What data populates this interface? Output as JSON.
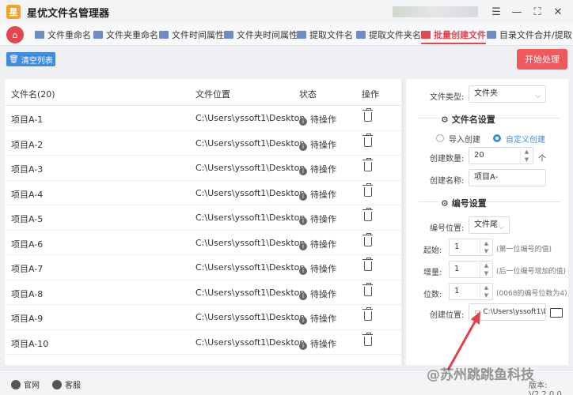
{
  "app": {
    "title": "星优文件名管理器",
    "logo": "星"
  },
  "window": {
    "icons": [
      "menu-icon",
      "minimize-icon",
      "maximize-icon",
      "close-icon"
    ]
  },
  "tabs": [
    {
      "label": "文件重命名"
    },
    {
      "label": "文件夹重命名"
    },
    {
      "label": "文件时间属性"
    },
    {
      "label": "文件夹时间属性"
    },
    {
      "label": "提取文件名"
    },
    {
      "label": "提取文件夹名"
    },
    {
      "label": "批量创建文件"
    },
    {
      "label": "目录文件合并/提取"
    }
  ],
  "active_tab": "批量创建文件",
  "toolbar": {
    "clear_label": "清空列表",
    "start_label": "开始处理"
  },
  "table": {
    "headers": {
      "name": "文件名(20)",
      "location": "文件位置",
      "status": "状态",
      "action": "操作"
    },
    "rows": [
      {
        "name": "项目A-1",
        "location": "C:\\Users\\yssoft1\\Desktop",
        "status": "待操作"
      },
      {
        "name": "项目A-2",
        "location": "C:\\Users\\yssoft1\\Desktop",
        "status": "待操作"
      },
      {
        "name": "项目A-3",
        "location": "C:\\Users\\yssoft1\\Desktop",
        "status": "待操作"
      },
      {
        "name": "项目A-4",
        "location": "C:\\Users\\yssoft1\\Desktop",
        "status": "待操作"
      },
      {
        "name": "项目A-5",
        "location": "C:\\Users\\yssoft1\\Desktop",
        "status": "待操作"
      },
      {
        "name": "项目A-6",
        "location": "C:\\Users\\yssoft1\\Desktop",
        "status": "待操作"
      },
      {
        "name": "项目A-7",
        "location": "C:\\Users\\yssoft1\\Desktop",
        "status": "待操作"
      },
      {
        "name": "项目A-8",
        "location": "C:\\Users\\yssoft1\\Desktop",
        "status": "待操作"
      },
      {
        "name": "项目A-9",
        "location": "C:\\Users\\yssoft1\\Desktop",
        "status": "待操作"
      },
      {
        "name": "项目A-10",
        "location": "C:\\Users\\yssoft1\\Desktop",
        "status": "待操作"
      }
    ]
  },
  "settings": {
    "file_type_label": "文件类型:",
    "file_type_value": "文件夹",
    "name_section": "文件名设置",
    "radio_import": "导入创建",
    "radio_custom": "自定义创建",
    "count_label": "创建数量:",
    "count_value": "20",
    "count_unit": "个",
    "name_label": "创建名称:",
    "name_value": "项目A-",
    "number_section": "编号设置",
    "num_pos_label": "编号位置:",
    "num_pos_value": "文件尾",
    "start_label": "起始:",
    "start_value": "1",
    "start_hint": "(第一位编号的值)",
    "increment_label": "增量:",
    "increment_value": "1",
    "increment_hint": "(后一位编号增加的值)",
    "digits_label": "位数:",
    "digits_value": "1",
    "digits_hint": "(0068的编号位数为4)",
    "location_label": "创建位置:",
    "location_value": "C:\\Users\\yssoft1\\De"
  },
  "footer": {
    "website": "官网",
    "support": "客服",
    "version": "版本: V2.2.0.0"
  },
  "watermark": "@苏州跳跳鱼科技",
  "colors": {
    "accent": "#e2474d",
    "primary_blue": "#3d8ee0",
    "start_red": "#f0595b"
  }
}
